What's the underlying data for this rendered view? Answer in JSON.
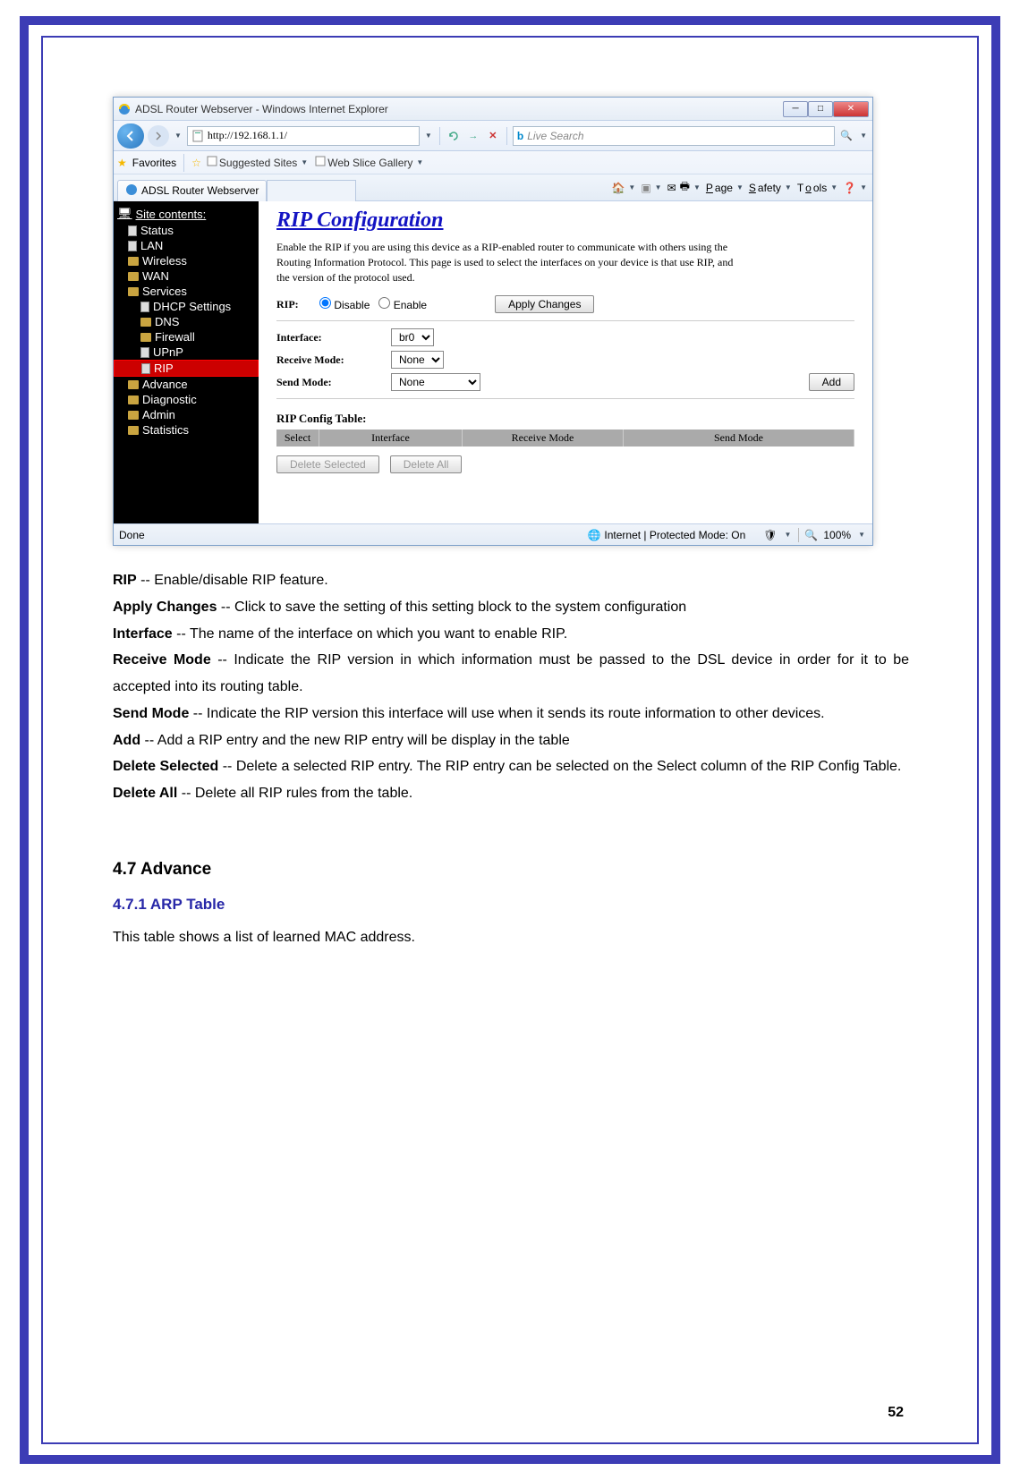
{
  "window": {
    "title": "ADSL Router Webserver - Windows Internet Explorer",
    "url": "http://192.168.1.1/",
    "search_placeholder": "Live Search",
    "favorites_label": "Favorites",
    "suggested_sites": "Suggested Sites",
    "web_slice": "Web Slice Gallery",
    "tab_title": "ADSL Router Webserver",
    "cmd": {
      "page": "Page",
      "safety": "Safety",
      "tools": "Tools"
    },
    "status_left": "Done",
    "status_mid": "Internet | Protected Mode: On",
    "zoom": "100%"
  },
  "sidebar": {
    "header": "Site contents:",
    "items": [
      "Status",
      "LAN",
      "Wireless",
      "WAN",
      "Services"
    ],
    "subitems": [
      "DHCP Settings",
      "DNS",
      "Firewall",
      "UPnP",
      "RIP"
    ],
    "tail": [
      "Advance",
      "Diagnostic",
      "Admin",
      "Statistics"
    ]
  },
  "main": {
    "title": "RIP Configuration",
    "desc": "Enable the RIP if you are using this device as a RIP-enabled router to communicate with others using the Routing Information Protocol. This page is used to select the interfaces on your device is that use RIP, and the version of the protocol used.",
    "rip_label": "RIP:",
    "disable": "Disable",
    "enable": "Enable",
    "apply": "Apply Changes",
    "iface_label": "Interface:",
    "iface_val": "br0",
    "recv_label": "Receive Mode:",
    "recv_val": "None",
    "send_label": "Send Mode:",
    "send_val": "None",
    "add": "Add",
    "table_title": "RIP Config Table:",
    "th": {
      "select": "Select",
      "iface": "Interface",
      "recv": "Receive Mode",
      "send": "Send Mode"
    },
    "del_sel": "Delete Selected",
    "del_all": "Delete All"
  },
  "doc": {
    "rip_b": "RIP",
    "rip_t": " -- Enable/disable RIP feature.",
    "apply_b": "Apply Changes",
    "apply_t": " -- Click to save the setting of this setting block to the system configuration",
    "iface_b": "Interface",
    "iface_t": " -- The name of the interface on which you want to enable RIP.",
    "recv_b": "Receive Mode",
    "recv_t": " -- Indicate the RIP version in which information must be passed to the DSL device in order for it to be accepted into its routing table.",
    "send_b": "Send Mode",
    "send_t": " -- Indicate the RIP version this interface will use when it sends its route information to other devices.",
    "add_b": "Add",
    "add_t": " -- Add a RIP entry and the new RIP entry will be display in the table",
    "delsel_b": "Delete Selected",
    "delsel_t": " -- Delete a selected RIP entry. The RIP entry can be selected on the Select column of the RIP Config Table.",
    "delall_b": "Delete All",
    "delall_t": " -- Delete all RIP rules from the table.",
    "sec": "4.7 Advance",
    "sub": "4.7.1 ARP Table",
    "sub_desc": "This table shows a list of learned MAC address."
  },
  "page_number": "52"
}
